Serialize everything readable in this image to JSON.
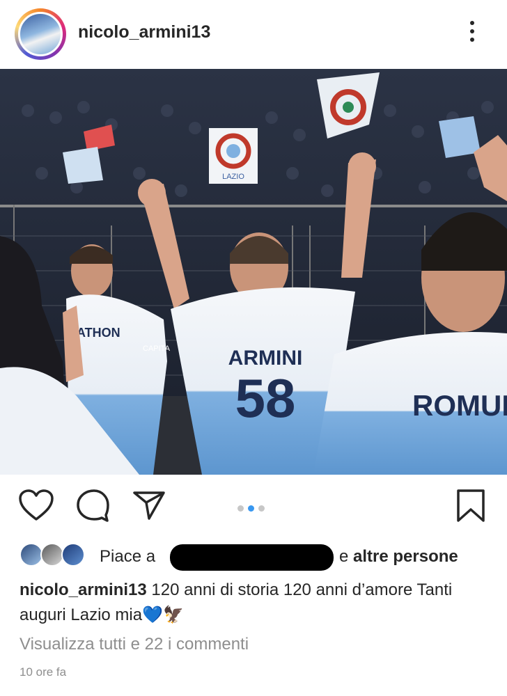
{
  "post": {
    "username": "nicolo_armini13",
    "actions": [
      "like",
      "comment",
      "share",
      "save"
    ],
    "carousel": {
      "count": 3,
      "active_index": 1
    },
    "likes": {
      "prefix": "Piace a",
      "and": "e",
      "others": "altre persone"
    },
    "caption": {
      "username": "nicolo_armini13",
      "text": "120 anni di storia  120 anni d’amore Tanti auguri Lazio mia💙🦅"
    },
    "comments_link": "Visualizza tutti e 22 i commenti",
    "time": "10 ore fa",
    "photo": {
      "jersey_center_name": "ARMINI",
      "jersey_center_number": "58",
      "jersey_right_name": "ROMUL",
      "left_shirt_text": "ATHON",
      "captain_band": "CAPITA",
      "banner_text": "LAZIO"
    }
  },
  "colors": {
    "text": "#262626",
    "muted": "#8e8e8e",
    "accent_blue": "#3897f0",
    "lazio_blue": "#6aa3d8"
  },
  "icons": [
    "more-options-icon",
    "heart-icon",
    "comment-icon",
    "share-icon",
    "bookmark-icon"
  ]
}
